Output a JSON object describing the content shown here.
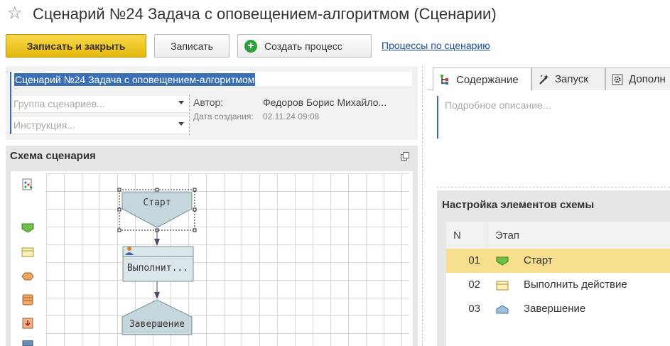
{
  "window": {
    "title": "Сценарий №24 Задача с оповещением-алгоритмом (Сценарии)"
  },
  "toolbar": {
    "save_close_label": "Записать и закрыть",
    "save_label": "Записать",
    "create_process_label": "Создать процесс",
    "processes_link": "Процессы по сценарию"
  },
  "form": {
    "name_value": "Сценарий №24 Задача с оповещением-алгоритмом",
    "group_placeholder": "Группа сценариев...",
    "instruction_placeholder": "Инструкция...",
    "author_label": "Автор:",
    "author_value": "Федоров Борис Михайло...",
    "created_label": "Дата создания:",
    "created_value": "02.11.24 09:08"
  },
  "schema": {
    "title": "Схема сценария",
    "nodes": {
      "start": "Старт",
      "action": "Выполнит...",
      "end": "Завершение"
    }
  },
  "tabs": [
    {
      "label": "Содержание",
      "icon": "content-icon",
      "active": true
    },
    {
      "label": "Запуск",
      "icon": "magic-wand-icon",
      "active": false
    },
    {
      "label": "Дополн",
      "icon": "settings-gear-icon",
      "active": false
    }
  ],
  "description": {
    "placeholder": "Подробное описание..."
  },
  "settings": {
    "title": "Настройка элементов схемы",
    "columns": {
      "n": "N",
      "stage": "Этап"
    },
    "rows": [
      {
        "n": "01",
        "stage": "Старт",
        "icon": "start-shape-icon",
        "selected": true
      },
      {
        "n": "02",
        "stage": "Выполнить действие",
        "icon": "action-shape-icon",
        "selected": false
      },
      {
        "n": "03",
        "stage": "Завершение",
        "icon": "end-shape-icon",
        "selected": false
      }
    ]
  },
  "colors": {
    "primary_button": "#f0c419",
    "selection": "#3b6fb6",
    "selected_row": "#f7de8c",
    "link": "#1a4d99",
    "node_fill": "#c5d7dd",
    "node_stroke": "#7a8f98"
  }
}
